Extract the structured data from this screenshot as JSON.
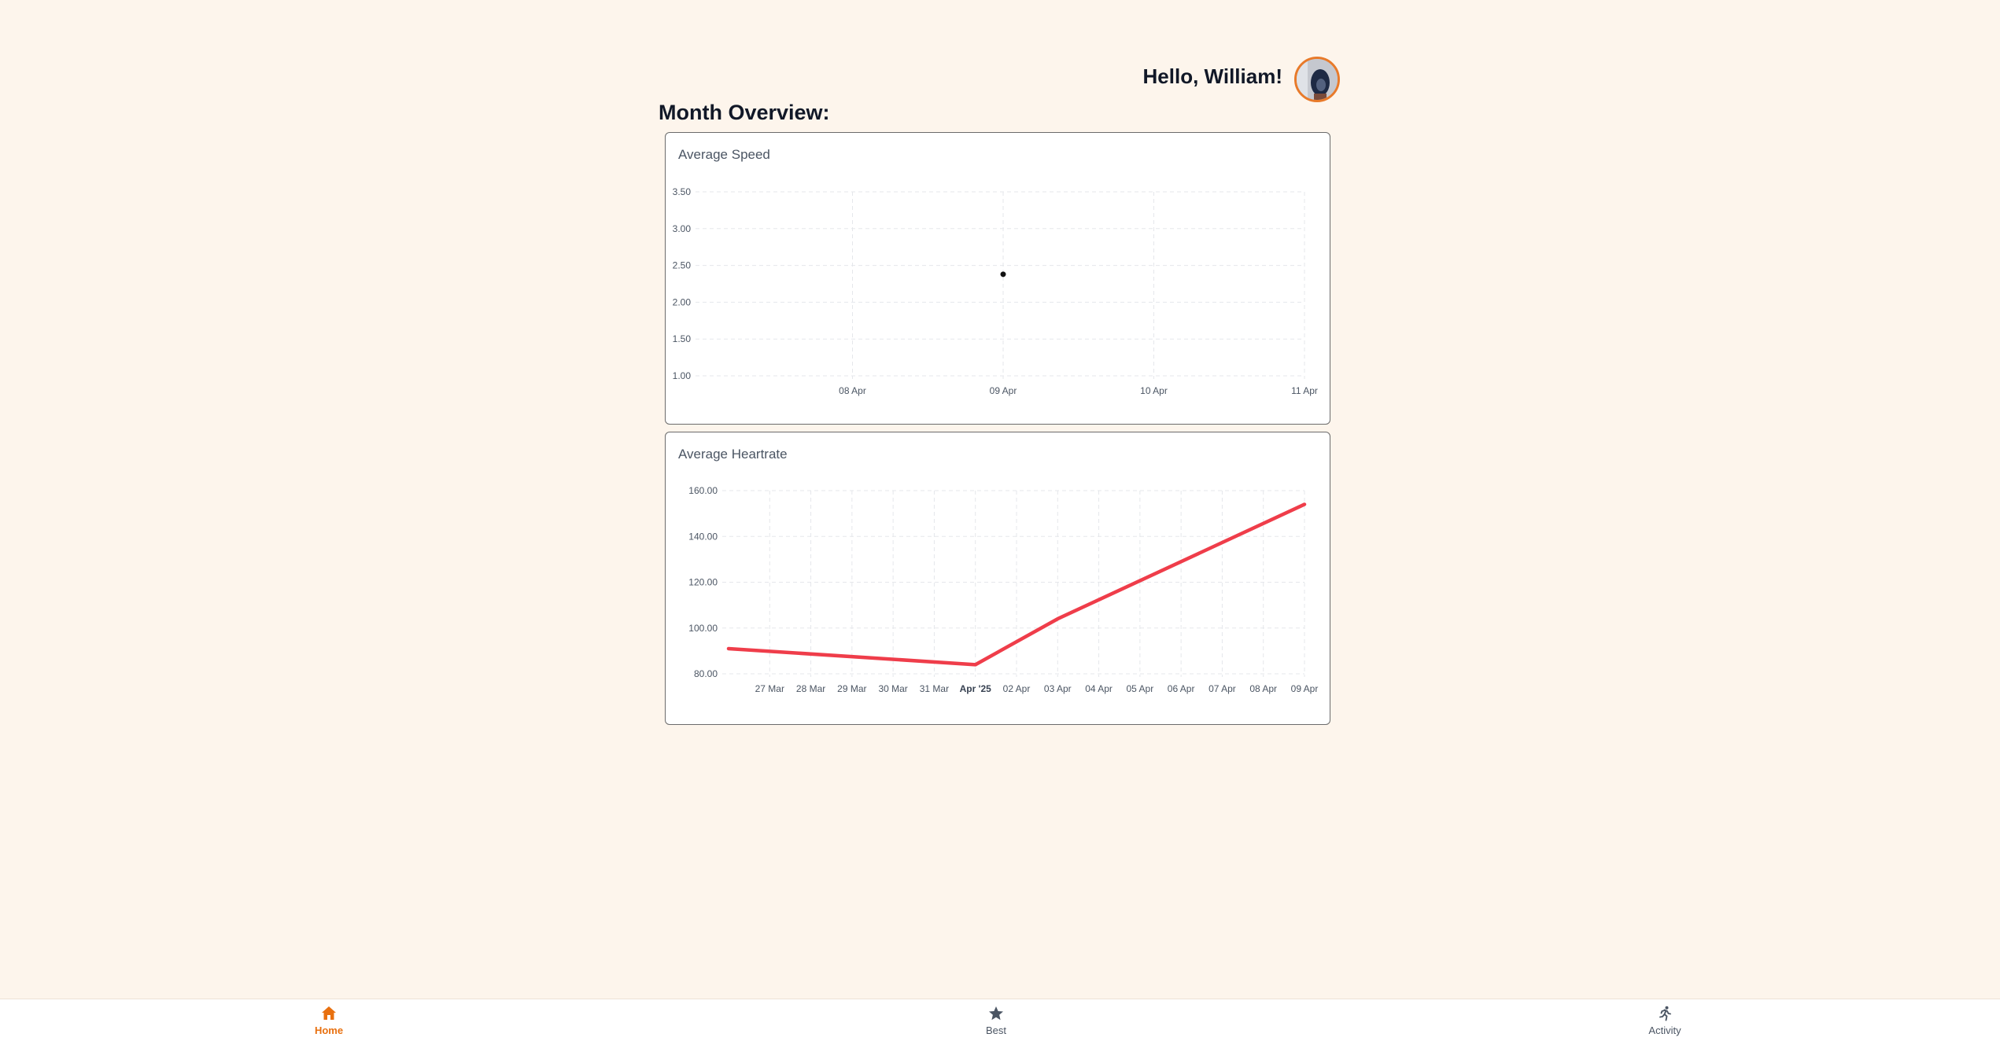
{
  "header": {
    "greeting": "Hello, William!"
  },
  "overview": {
    "title": "Month Overview:"
  },
  "accent_color": "#e8700f",
  "line_color": "#ef3d4a",
  "chart_data": [
    {
      "type": "scatter",
      "title": "Average Speed",
      "x_ticks": [
        "08 Apr",
        "09 Apr",
        "10 Apr",
        "11 Apr"
      ],
      "y_ticks": [
        "1.00",
        "1.50",
        "2.00",
        "2.50",
        "3.00",
        "3.50"
      ],
      "ylim": [
        1,
        3.5
      ],
      "xlim": [
        "2025-04-07",
        "2025-04-11"
      ],
      "points": [
        {
          "x": "2025-04-09",
          "y": 2.38
        }
      ],
      "grid": true
    },
    {
      "type": "line",
      "title": "Average Heartrate",
      "x_ticks": [
        "27 Mar",
        "28 Mar",
        "29 Mar",
        "30 Mar",
        "31 Mar",
        "Apr '25",
        "02 Apr",
        "03 Apr",
        "04 Apr",
        "05 Apr",
        "06 Apr",
        "07 Apr",
        "08 Apr",
        "09 Apr"
      ],
      "y_ticks": [
        "80.00",
        "100.00",
        "120.00",
        "140.00",
        "160.00"
      ],
      "ylim": [
        80,
        160
      ],
      "xlim": [
        "2025-03-26",
        "2025-04-09"
      ],
      "points": [
        {
          "x": "2025-03-26",
          "y": 91
        },
        {
          "x": "2025-04-01",
          "y": 84
        },
        {
          "x": "2025-04-03",
          "y": 104
        },
        {
          "x": "2025-04-09",
          "y": 154
        }
      ],
      "grid": true
    }
  ],
  "nav": {
    "items": [
      {
        "label": "Home",
        "icon": "home-icon",
        "active": true
      },
      {
        "label": "Best",
        "icon": "star-icon",
        "active": false
      },
      {
        "label": "Activity",
        "icon": "running-icon",
        "active": false
      }
    ]
  }
}
